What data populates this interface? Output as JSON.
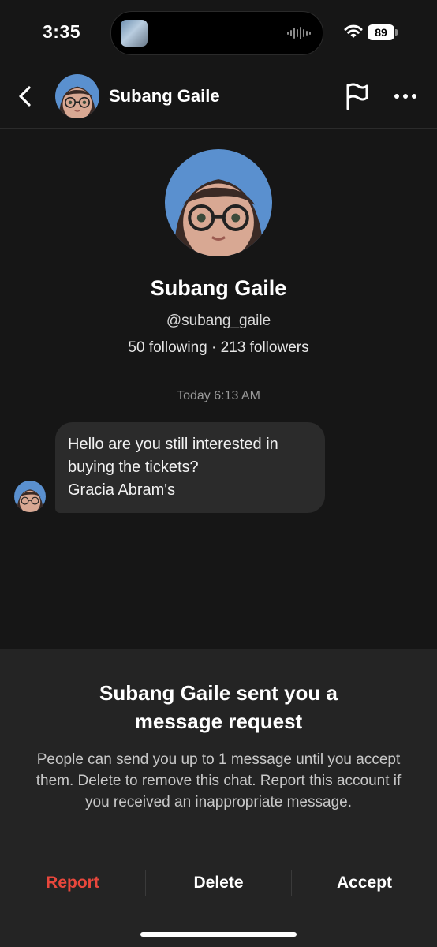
{
  "status_bar": {
    "time": "3:35",
    "battery": "89"
  },
  "header": {
    "name": "Subang Gaile"
  },
  "profile": {
    "name": "Subang Gaile",
    "handle": "@subang_gaile",
    "stats": "50 following · 213 followers"
  },
  "chat": {
    "timestamp": "Today 6:13 AM",
    "messages": [
      {
        "lines": [
          "Hello are you still interested in",
          "buying the tickets?",
          "Gracia Abram's"
        ]
      }
    ]
  },
  "request": {
    "title_line1": "Subang Gaile sent you a",
    "title_line2": "message request",
    "description": "People can send you up to 1 message until you accept them. Delete to remove this chat. Report this account if you received an inappropriate message.",
    "report_label": "Report",
    "delete_label": "Delete",
    "accept_label": "Accept",
    "report_color": "#e8473c"
  },
  "icons": [
    "back-chevron-icon",
    "flag-icon",
    "more-icon",
    "wifi-icon",
    "battery-icon",
    "audio-wave-icon"
  ]
}
